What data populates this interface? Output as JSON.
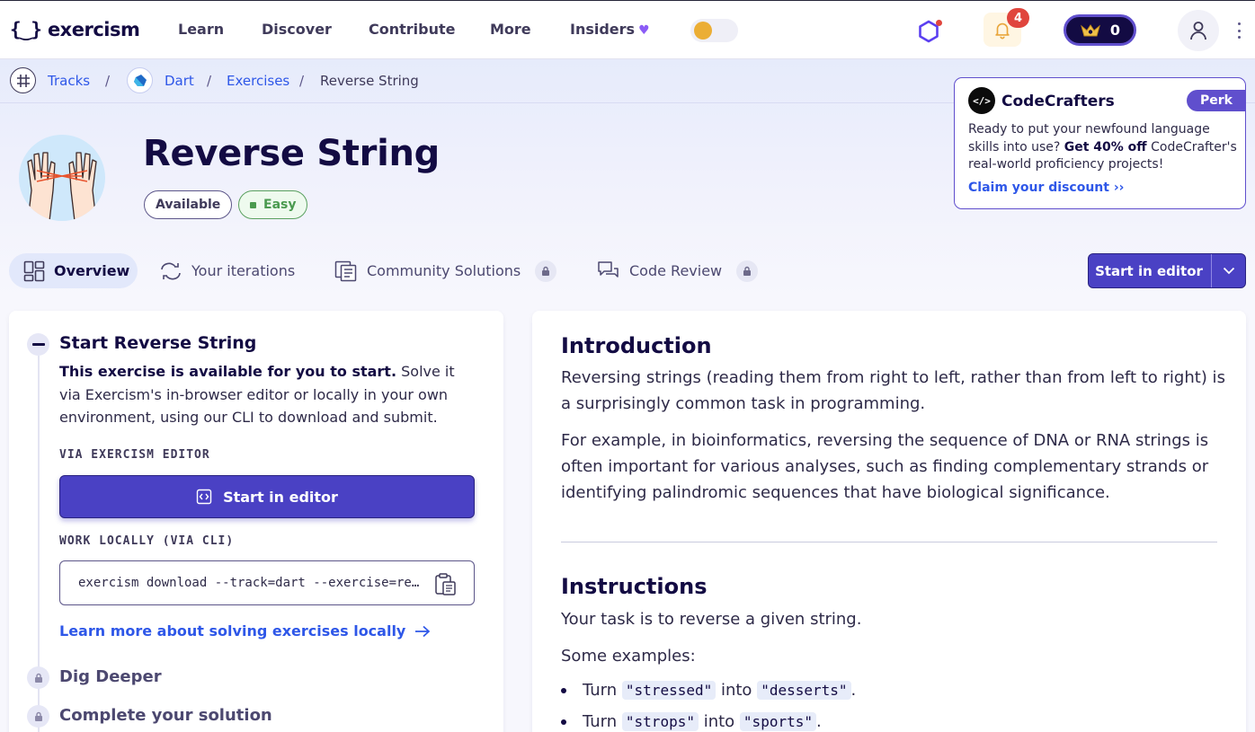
{
  "nav": {
    "logo_mark": "{‿}",
    "logo_text": "exercism",
    "links": [
      "Learn",
      "Discover",
      "Contribute",
      "More",
      "Insiders"
    ],
    "notifications_count": "4",
    "reputation": "0"
  },
  "breadcrumb": {
    "tracks": "Tracks",
    "track": "Dart",
    "exercises": "Exercises",
    "current": "Reverse String",
    "separator": "/"
  },
  "exercise": {
    "title": "Reverse String",
    "status": "Available",
    "difficulty": "Easy"
  },
  "perk": {
    "name": "CodeCrafters",
    "logo": "</>",
    "badge": "Perk",
    "text_before": "Ready to put your newfound language skills into use? ",
    "text_bold": "Get 40% off",
    "text_after": " CodeCrafter's real-world proficiency projects!",
    "link": "Claim your discount"
  },
  "tabs": {
    "overview": "Overview",
    "iterations": "Your iterations",
    "community": "Community Solutions",
    "review": "Code Review",
    "start_editor": "Start in editor"
  },
  "start_panel": {
    "title": "Start Reverse String",
    "desc_bold": "This exercise is available for you to start.",
    "desc_rest": " Solve it via Exercism's in-browser editor or locally in your own environment, using our CLI to download and submit.",
    "via_editor_label": "VIA EXERCISM EDITOR",
    "start_button": "Start in editor",
    "work_locally_label": "WORK LOCALLY (VIA CLI)",
    "cli_command": "exercism download --track=dart --exercise=reverse-string",
    "learn_more": "Learn more about solving exercises locally",
    "dig_deeper": "Dig Deeper",
    "complete": "Complete your solution"
  },
  "instructions": {
    "intro_heading": "Introduction",
    "intro_p1": "Reversing strings (reading them from right to left, rather than from left to right) is a surprisingly common task in programming.",
    "intro_p2": "For example, in bioinformatics, reversing the sequence of DNA or RNA strings is often important for various analyses, such as finding complementary strands or identifying palindromic sequences that have biological significance.",
    "instr_heading": "Instructions",
    "instr_p1": "Your task is to reverse a given string.",
    "instr_p2": "Some examples:",
    "ex1_turn": "Turn",
    "ex1_from": "\"stressed\"",
    "ex1_into": "into",
    "ex1_to": "\"desserts\"",
    "ex1_end": ".",
    "ex2_turn": "Turn",
    "ex2_from": "\"strops\"",
    "ex2_into": "into",
    "ex2_to": "\"sports\"",
    "ex2_end": "."
  },
  "colors": {
    "primary": "#4a41c4",
    "link": "#2e57e8",
    "easy": "#4a9a4f",
    "notification": "#e0453d"
  }
}
